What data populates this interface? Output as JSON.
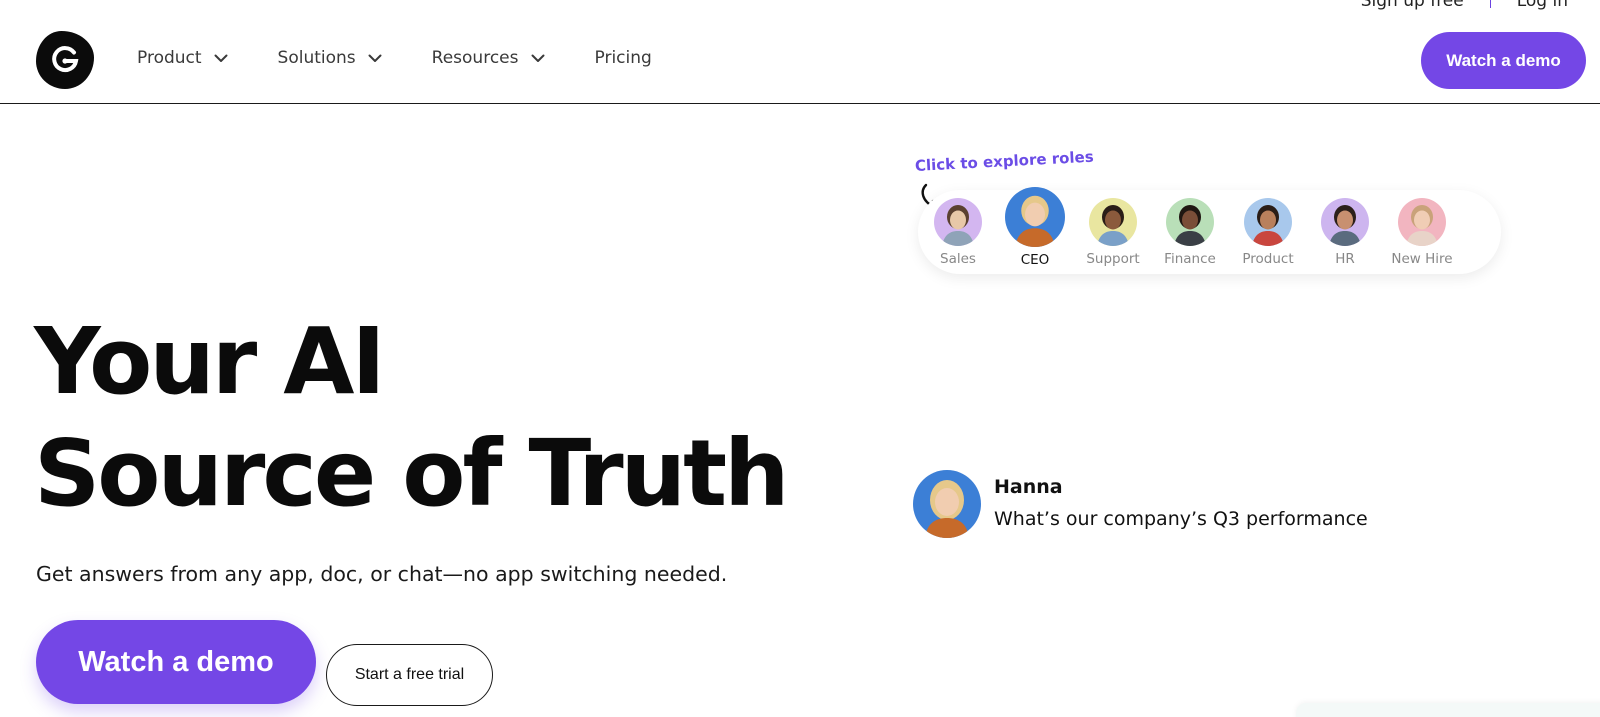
{
  "utility": {
    "signup": "Sign up free",
    "login": "Log in"
  },
  "nav": [
    {
      "label": "Product",
      "has_dropdown": true
    },
    {
      "label": "Solutions",
      "has_dropdown": true
    },
    {
      "label": "Resources",
      "has_dropdown": true
    },
    {
      "label": "Pricing",
      "has_dropdown": false
    }
  ],
  "header": {
    "cta": "Watch a demo"
  },
  "hero": {
    "title_line1": "Your AI",
    "title_line2": "Source of Truth",
    "subtitle": "Get answers from any app, doc, or chat—no app switching needed.",
    "primary_cta": "Watch a demo",
    "secondary_cta": "Start a free trial"
  },
  "roles": {
    "hint": "Click to explore roles",
    "items": [
      {
        "label": "Sales",
        "ring": "#d3b6f0",
        "skin": "#e8c8a8",
        "hair": "#5b4030",
        "shirt": "#8fa3b8"
      },
      {
        "label": "CEO",
        "ring": "#3c7fd6",
        "skin": "#f1cdb0",
        "hair": "#e6c88a",
        "shirt": "#c66a2a",
        "active": true
      },
      {
        "label": "Support",
        "ring": "#e9e6a0",
        "skin": "#8b5a3c",
        "hair": "#2a1d17",
        "shirt": "#7aa0c8"
      },
      {
        "label": "Finance",
        "ring": "#b9dfb8",
        "skin": "#7a4e38",
        "hair": "#1f1712",
        "shirt": "#3a3f46"
      },
      {
        "label": "Product",
        "ring": "#a8c8ec",
        "skin": "#b9805c",
        "hair": "#2a1d17",
        "shirt": "#c9463e"
      },
      {
        "label": "HR",
        "ring": "#cdb5ef",
        "skin": "#c89070",
        "hair": "#2b1f1a",
        "shirt": "#5a6b7e"
      },
      {
        "label": "New Hire",
        "ring": "#f2b5c0",
        "skin": "#f0cdb5",
        "hair": "#c9a27a",
        "shirt": "#e8d3c8"
      }
    ]
  },
  "chat": {
    "name": "Hanna",
    "message": "What’s our company’s Q3 performance"
  },
  "colors": {
    "accent": "#7447e6",
    "hint": "#6b4de6"
  }
}
